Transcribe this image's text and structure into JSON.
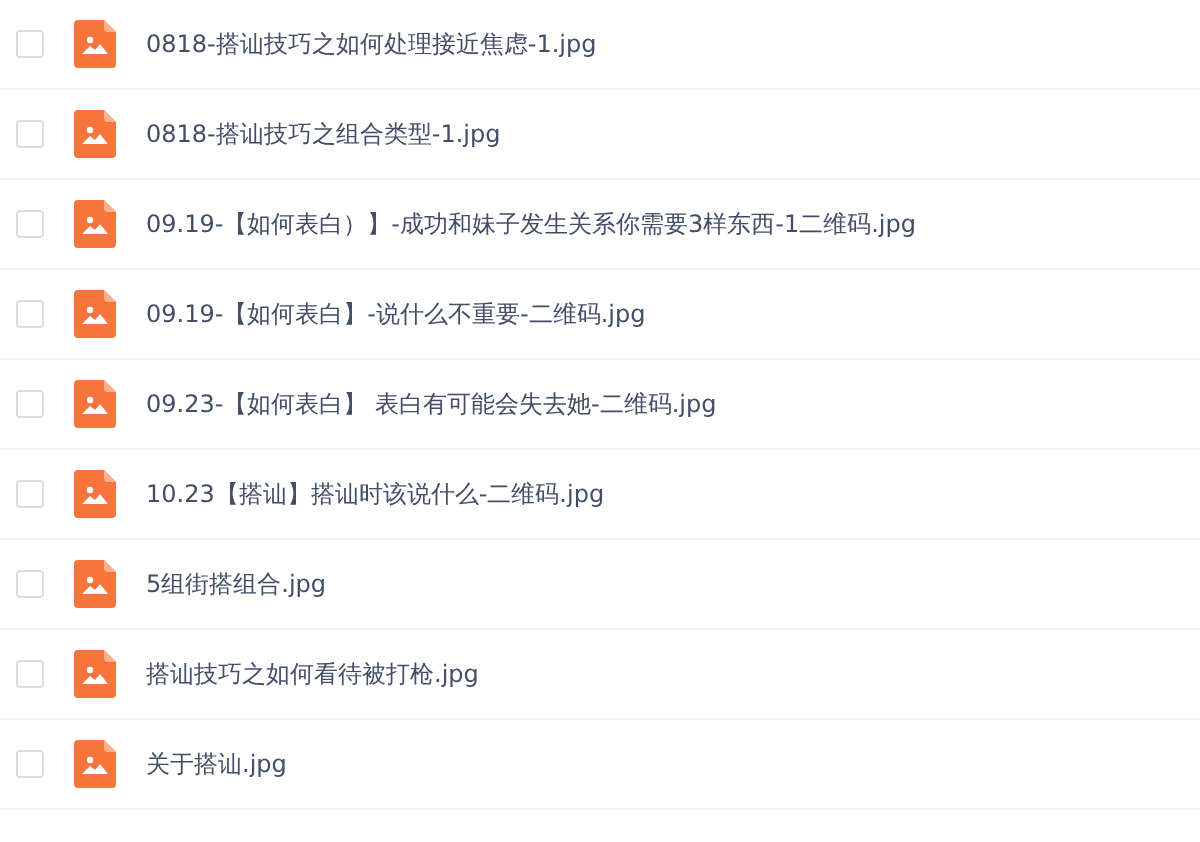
{
  "files": [
    {
      "name": "0818-搭讪技巧之如何处理接近焦虑-1.jpg",
      "checked": false
    },
    {
      "name": "0818-搭讪技巧之组合类型-1.jpg",
      "checked": false
    },
    {
      "name": "09.19-【如何表白）】-成功和妹子发生关系你需要3样东西-1二维码.jpg",
      "checked": false
    },
    {
      "name": "09.19-【如何表白】-说什么不重要-二维码.jpg",
      "checked": false
    },
    {
      "name": "09.23-【如何表白】 表白有可能会失去她-二维码.jpg",
      "checked": false
    },
    {
      "name": "10.23【搭讪】搭讪时该说什么-二维码.jpg",
      "checked": false
    },
    {
      "name": "5组街搭组合.jpg",
      "checked": false
    },
    {
      "name": "搭讪技巧之如何看待被打枪.jpg",
      "checked": false
    },
    {
      "name": "关于搭讪.jpg",
      "checked": false
    }
  ]
}
